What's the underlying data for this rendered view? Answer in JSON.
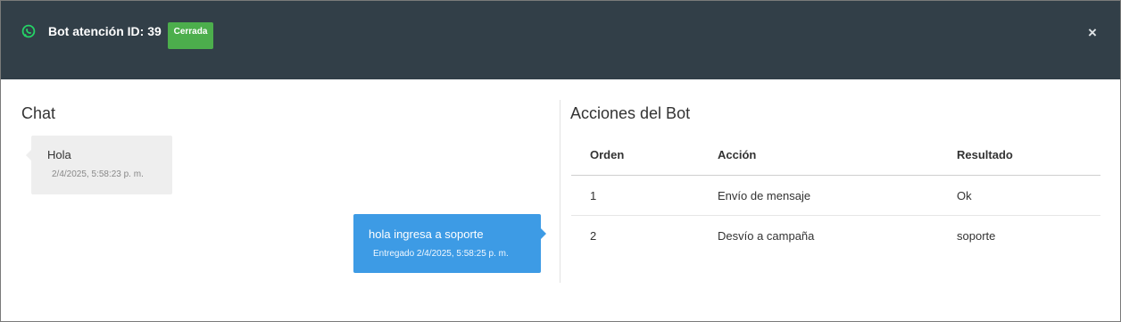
{
  "header": {
    "title": "Bot atención ID: 39",
    "status_badge": "Cerrada",
    "close_label": "×",
    "icon": "whatsapp-icon",
    "bg_color": "#323f48",
    "badge_color": "#4cae4c"
  },
  "chat": {
    "title": "Chat",
    "messages": [
      {
        "text": "Hola",
        "time": "2/4/2025, 5:58:23 p. m."
      },
      {
        "text": "hola ingresa a soporte",
        "time": "Entregado 2/4/2025, 5:58:25 p. m."
      }
    ],
    "out_bubble_color": "#3d9be5",
    "in_bubble_color": "#eeeeee"
  },
  "acciones": {
    "title": "Acciones del Bot",
    "columns": [
      "Orden",
      "Acción",
      "Resultado"
    ],
    "rows": [
      [
        "1",
        "Envío de mensaje",
        "Ok"
      ],
      [
        "2",
        "Desvío a campaña",
        "soporte"
      ]
    ]
  }
}
